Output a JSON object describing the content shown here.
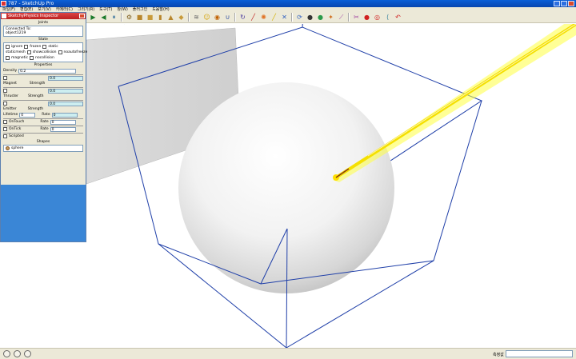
{
  "window": {
    "title": "787 - SketchUp Pro"
  },
  "menubar": {
    "items": [
      "파일(F)",
      "편집(E)",
      "보기(V)",
      "카메라(C)",
      "그리기(R)",
      "도구(T)",
      "창(W)",
      "플러그인",
      "도움말(H)"
    ]
  },
  "toolbar": {
    "buttons": [
      {
        "name": "play-icon",
        "glyph": "▶",
        "color": "#1a7a2a"
      },
      {
        "name": "rewind-icon",
        "glyph": "◀",
        "color": "#1a7a2a"
      },
      {
        "name": "pause-icon",
        "glyph": "⏸",
        "color": "#2a6a9a"
      },
      {
        "name": "gear-icon",
        "glyph": "⚙",
        "color": "#806020"
      },
      {
        "name": "box-icon",
        "glyph": "■",
        "color": "#b8862c"
      },
      {
        "name": "box-icon",
        "glyph": "■",
        "color": "#c89a3a"
      },
      {
        "name": "cylinder-icon",
        "glyph": "▮",
        "color": "#b8862c"
      },
      {
        "name": "cone-icon",
        "glyph": "▲",
        "color": "#b8862c"
      },
      {
        "name": "bottle-icon",
        "glyph": "◆",
        "color": "#c89a3a"
      },
      {
        "name": "spring-icon",
        "glyph": "≋",
        "color": "#666666"
      },
      {
        "name": "smiley-icon",
        "glyph": "☺",
        "color": "#d4a000"
      },
      {
        "name": "pin-icon",
        "glyph": "◉",
        "color": "#c06000"
      },
      {
        "name": "magnet-icon",
        "glyph": "∪",
        "color": "#2a4aa0"
      },
      {
        "name": "rotate-icon",
        "glyph": "↻",
        "color": "#4a3aa0"
      },
      {
        "name": "line-icon",
        "glyph": "╱",
        "color": "#c02020"
      },
      {
        "name": "gear-icon",
        "glyph": "✺",
        "color": "#e07020"
      },
      {
        "name": "pen-icon",
        "glyph": "╱",
        "color": "#d4b000"
      },
      {
        "name": "cross-icon",
        "glyph": "✕",
        "color": "#3060c0"
      },
      {
        "name": "refresh-icon",
        "glyph": "⟳",
        "color": "#3060c0"
      },
      {
        "name": "ball-icon",
        "glyph": "●",
        "color": "#333333"
      },
      {
        "name": "globe-icon",
        "glyph": "●",
        "color": "#2a9a4a"
      },
      {
        "name": "star-icon",
        "glyph": "✦",
        "color": "#d07020"
      },
      {
        "name": "wand-icon",
        "glyph": "⟋",
        "color": "#a040a0"
      },
      {
        "name": "scissors-icon",
        "glyph": "✂",
        "color": "#a040a0"
      },
      {
        "name": "record-icon",
        "glyph": "●",
        "color": "#d02020"
      },
      {
        "name": "target-icon",
        "glyph": "◎",
        "color": "#d02020"
      },
      {
        "name": "curve-icon",
        "glyph": "⟨",
        "color": "#2a7a9a"
      },
      {
        "name": "undo-icon",
        "glyph": "↶",
        "color": "#d02020"
      }
    ]
  },
  "panel": {
    "title": "SketchyPhysics Inspector",
    "joints": {
      "heading": "Joints",
      "connected_label": "Connected To:",
      "connected_value": "object1219"
    },
    "state": {
      "heading": "State",
      "checkboxes": [
        "ignore",
        "frozen",
        "static",
        "staticmesh",
        "showcollision",
        "noautofreeze",
        "magnetic",
        "nocollision"
      ]
    },
    "properties": {
      "heading": "Properties",
      "density_label": "Density",
      "density_value": "0.2",
      "magnet_label": "Magnet",
      "magnet_strength_label": "Strength",
      "magnet_strength_value": "0.0",
      "thruster_label": "Thruster",
      "thruster_strength_label": "Strength",
      "thruster_strength_value": "0.0",
      "emitter_label": "Emitter",
      "emitter_strength_label": "Strength",
      "emitter_strength_value": "0.0",
      "lifetime_label": "Lifetime",
      "lifetime_value": "0",
      "rate_label": "Rate",
      "rate_value": "0",
      "ontouch_label": "OnTouch",
      "ontouch_rate_label": "Rate",
      "ontouch_rate_value": "0",
      "ontick_label": "OnTick",
      "ontick_rate_label": "Rate",
      "ontick_rate_value": "0",
      "scripted_label": "Scripted"
    },
    "shapes": {
      "heading": "Shapes",
      "items": [
        "sphere"
      ]
    }
  },
  "statusbar": {
    "label": "측정값"
  },
  "colors": {
    "box_edge": "#1f3fa8",
    "beam": "#ffff40",
    "panel_blue": "#3a86d6"
  }
}
